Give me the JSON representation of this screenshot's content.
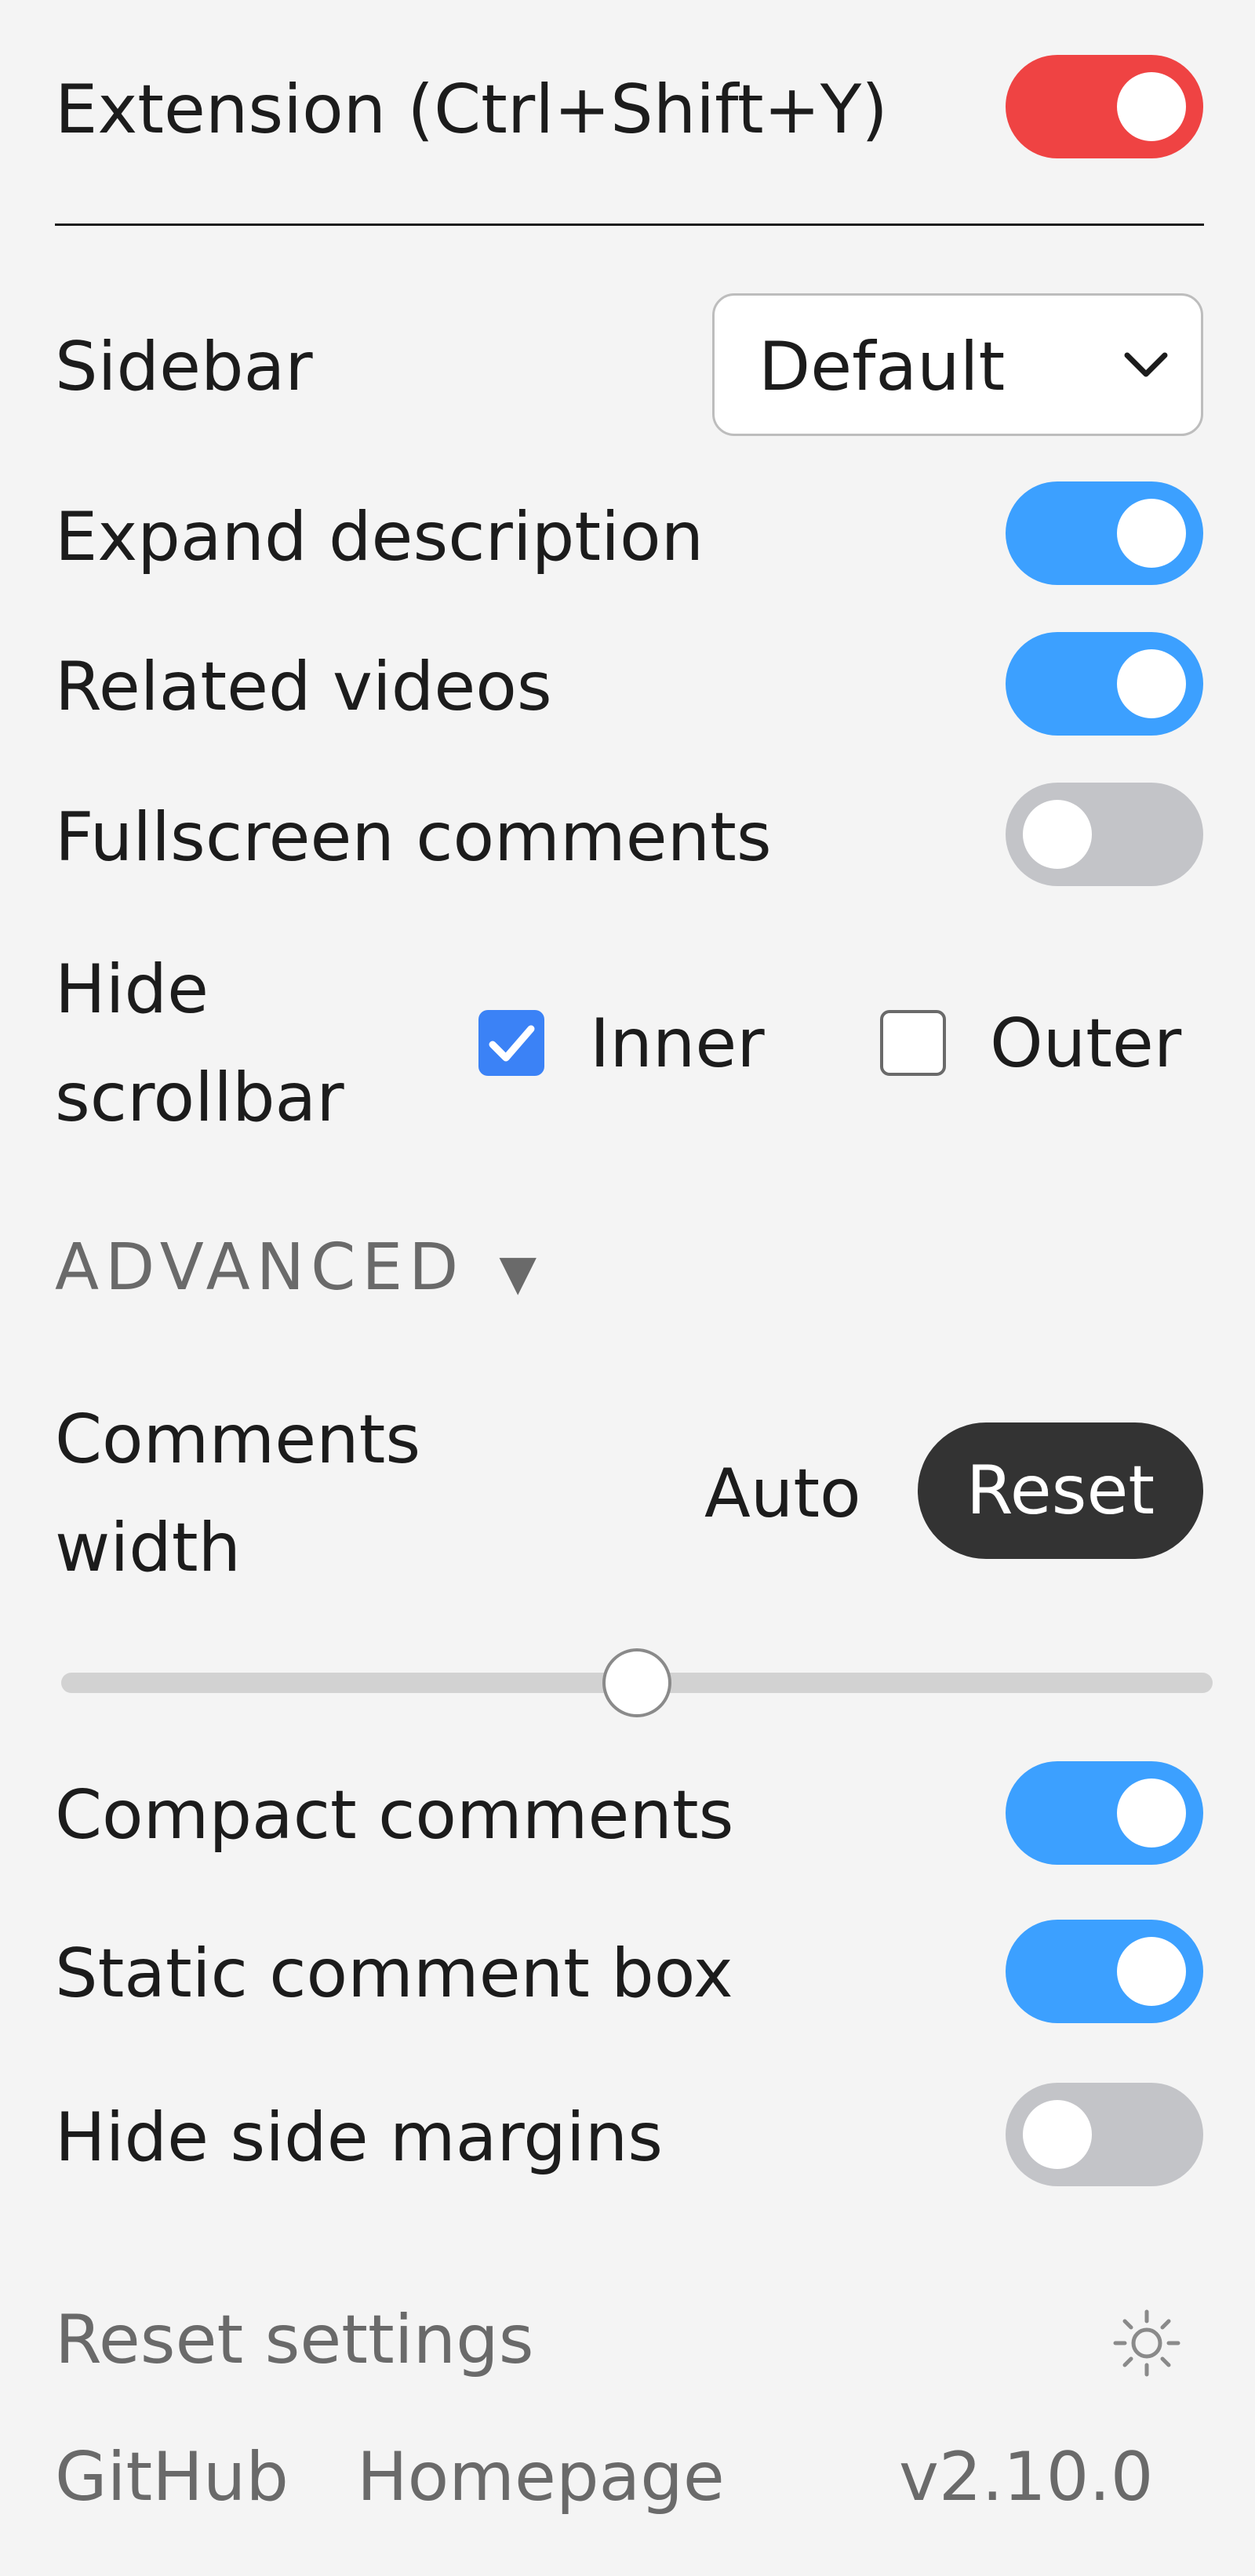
{
  "colors": {
    "accent_blue": "#3ca0ff",
    "toggle_red": "#ef4343",
    "toggle_off": "#c3c4c8",
    "checkbox_blue": "#3b82f6"
  },
  "extension": {
    "label": "Extension (Ctrl+Shift+Y)",
    "enabled": true
  },
  "sidebar": {
    "label": "Sidebar",
    "selected": "Default"
  },
  "toggles": {
    "expand_description": {
      "label": "Expand description",
      "on": true
    },
    "related_videos": {
      "label": "Related videos",
      "on": true
    },
    "fullscreen_comments": {
      "label": "Fullscreen comments",
      "on": false
    }
  },
  "hide_scrollbar": {
    "label_line1": "Hide",
    "label_line2": "scrollbar",
    "inner": {
      "label": "Inner",
      "checked": true
    },
    "outer": {
      "label": "Outer",
      "checked": false
    }
  },
  "advanced": {
    "label": "ADVANCED",
    "arrow": "▼"
  },
  "comments_width": {
    "label_line1": "Comments",
    "label_line2": "width",
    "value_text": "Auto",
    "reset_label": "Reset",
    "slider_fraction": 0.5
  },
  "advanced_toggles": {
    "compact_comments": {
      "label": "Compact comments",
      "on": true
    },
    "static_comment_box": {
      "label": "Static comment box",
      "on": true
    },
    "hide_side_margins": {
      "label": "Hide side margins",
      "on": false
    }
  },
  "footer": {
    "reset_settings": "Reset settings",
    "theme_icon": "sun-icon",
    "github": "GitHub",
    "homepage": "Homepage",
    "version": "v2.10.0"
  }
}
